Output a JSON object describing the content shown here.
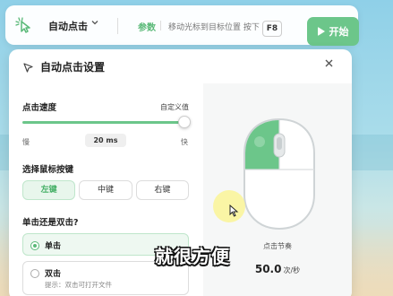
{
  "toolbar": {
    "logo_icon": "cursor-click-icon",
    "mode_label": "自动点击",
    "chevron_icon": "chevron-down-icon",
    "param_label": "参数",
    "hint_text": "移动光标到目标位置 按下",
    "hotkey": "F8",
    "start_label": "开始",
    "start_icon": "play-icon"
  },
  "dialog": {
    "title": "自动点击设置",
    "title_icon": "cursor-pointer-icon",
    "close_icon": "close-icon",
    "speed": {
      "label": "点击速度",
      "custom_label": "自定义值",
      "slow_label": "慢",
      "fast_label": "快",
      "value_text": "20 ms",
      "slider_position": 0.95
    },
    "mouse_button": {
      "label": "选择鼠标按键",
      "options": [
        "左键",
        "中键",
        "右键"
      ],
      "selected": "左键"
    },
    "click_type": {
      "label": "单击还是双击?",
      "single_label": "单击",
      "double_label": "双击",
      "double_hint": "提示：双击可打开文件",
      "selected": "单击"
    },
    "preview": {
      "mouse_icon": "mouse-left-button-icon",
      "rhythm_label": "点击节奏",
      "rate_value": "50.0",
      "rate_unit": "次/秒"
    }
  },
  "caption": "就很方便",
  "colors": {
    "accent": "#6cc68a",
    "accent_text": "#46b067",
    "accent_light": "#e8f6ec"
  }
}
